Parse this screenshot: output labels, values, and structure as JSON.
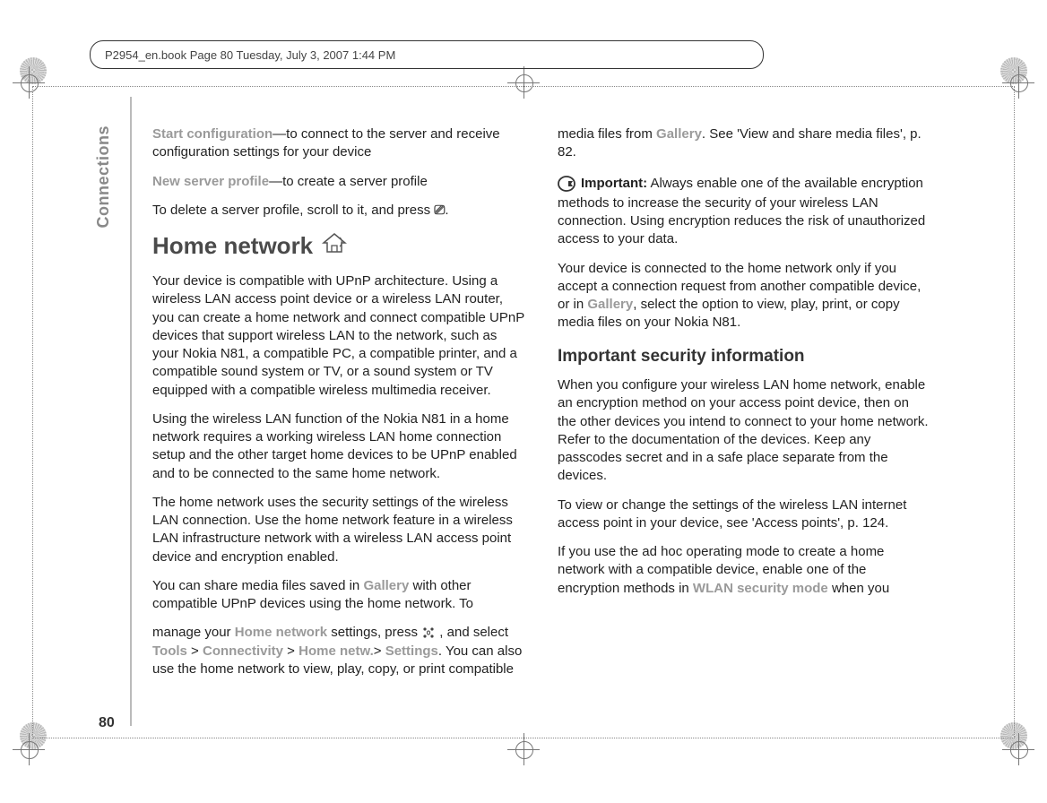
{
  "header": "P2954_en.book  Page 80  Tuesday, July 3, 2007  1:44 PM",
  "side_tab": "Connections",
  "page_number": "80",
  "c1": {
    "p1_a": "Start configuration",
    "p1_b": "—to connect to the server and receive configuration settings for your device",
    "p2_a": "New server profile",
    "p2_b": "—to create a server profile",
    "p3": "To delete a server profile, scroll to it, and press ",
    "p3_icon_name": "clear-key-icon",
    "h1": "Home network",
    "p4": "Your device is compatible with UPnP architecture. Using a wireless LAN access point device or a wireless LAN router, you can create a home network and connect compatible UPnP devices that support wireless LAN to the network, such as your Nokia N81, a compatible PC, a compatible printer, and a compatible sound system or TV, or a sound system or TV equipped with a compatible wireless multimedia receiver.",
    "p5": "Using the wireless LAN function of the Nokia N81 in a home network requires a working wireless LAN home connection setup and the other target home devices to be UPnP enabled and to be connected to the same home network.",
    "p6": "The home network uses the security settings of the wireless LAN connection. Use the home network feature in a wireless LAN infrastructure network with a wireless LAN access point device and encryption enabled.",
    "p7_a": "You can share media files saved in ",
    "p7_gallery": "Gallery",
    "p7_b": " with other compatible UPnP devices using the home network. To"
  },
  "c2": {
    "p1_a": "manage your ",
    "p1_hn": "Home network",
    "p1_b": " settings, press ",
    "p1_c": " , and select ",
    "p1_tools": "Tools",
    "p1_gt1": " > ",
    "p1_conn": "Connectivity",
    "p1_gt2": " > ",
    "p1_hnetw": "Home netw.",
    "p1_gt3": "> ",
    "p1_settings": "Settings",
    "p1_d": ". You can also use the home network to view, play, copy, or print compatible media files from ",
    "p1_gallery": "Gallery",
    "p1_e": ". See 'View and share media files', p. 82.",
    "imp_label": "Important:",
    "imp_text": " Always enable one of the available encryption methods to increase the security of your wireless LAN connection. Using encryption reduces the risk of unauthorized access to your data.",
    "p3_a": "Your device is connected to the home network only if you accept a connection request from another compatible device, or in ",
    "p3_gallery": "Gallery",
    "p3_b": ", select the option to view, play, print, or copy media files on your Nokia N81.",
    "h2": "Important security information",
    "p4": "When you configure your wireless LAN home network, enable an encryption method on your access point device, then on the other devices you intend to connect to your home network. Refer to the documentation of the devices. Keep any passcodes secret and in a safe place separate from the devices.",
    "p5": "To view or change the settings of the wireless LAN internet access point in your device, see 'Access points', p. 124.",
    "p6_a": "If you use the ad hoc operating mode to create a home network with a compatible device, enable one of the encryption methods in ",
    "p6_wlan": "WLAN security mode",
    "p6_b": " when you"
  }
}
